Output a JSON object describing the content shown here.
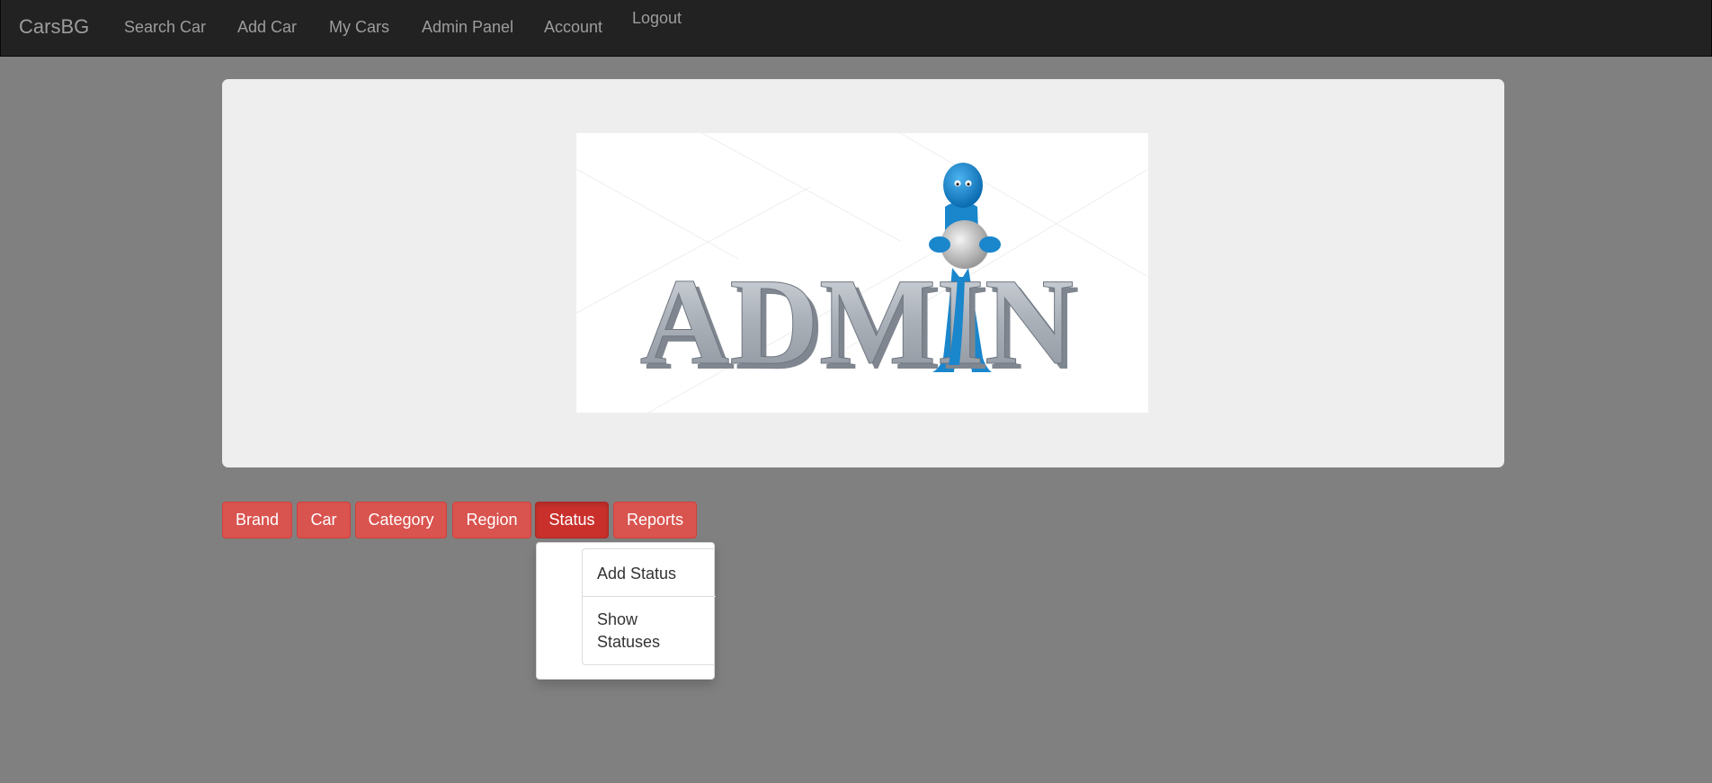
{
  "navbar": {
    "brand": "CarsBG",
    "links": [
      "Search Car",
      "Add Car",
      "My Cars",
      "Admin Panel",
      "Account"
    ],
    "logout": "Logout"
  },
  "hero": {
    "image_alt": "ADMIN",
    "image_text": "ADMIN",
    "image_icon": "admin-figure-icon"
  },
  "admin_buttons": [
    "Brand",
    "Car",
    "Category",
    "Region",
    "Status",
    "Reports"
  ],
  "active_button": "Status",
  "dropdown": {
    "items": [
      "Add Status",
      "Show Statuses"
    ]
  },
  "colors": {
    "navbar": "#222222",
    "page_background": "#808080",
    "button_danger": "#d9534f",
    "button_active": "#c9302c",
    "jumbotron": "#eeeeee"
  }
}
